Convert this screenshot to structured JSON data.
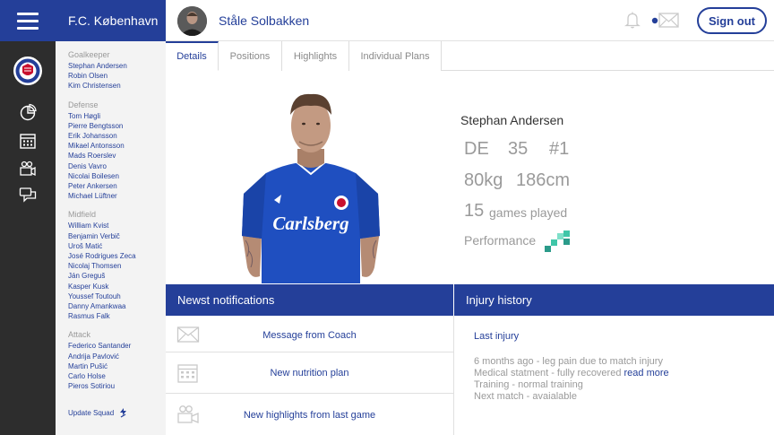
{
  "sidebar": {
    "team_name": "F.C. København",
    "groups": [
      {
        "title": "Goalkeeper",
        "players": [
          "Stephan Andersen",
          "Robin Olsen",
          "Kim Christensen"
        ]
      },
      {
        "title": "Defense",
        "players": [
          "Tom Høgli",
          "Pierre Bengtsson",
          "Erik Johansson",
          "Mikael Antonsson",
          "Mads Roerslev",
          "Denis Vavro",
          "Nicolai Boilesen",
          "Peter Ankersen",
          "Michael Lüftner"
        ]
      },
      {
        "title": "Midfield",
        "players": [
          "William Kvist",
          "Benjamin Verbič",
          "Uroš Matić",
          "José Rodrigues Zeca",
          "Nicolaj Thomsen",
          "Ján Greguš",
          "Kasper Kusk",
          "Youssef Toutouh",
          "Danny Amankwaa",
          "Rasmus Falk"
        ]
      },
      {
        "title": "Attack",
        "players": [
          "Federico Santander",
          "Andrija Pavlović",
          "Martin Pušić",
          "Carlo Holse",
          "Pieros Sotiriou"
        ]
      }
    ],
    "update_label": "Update Squad"
  },
  "header": {
    "coach_name": "Ståle Solbakken",
    "signout_label": "Sign out"
  },
  "tabs": [
    "Details",
    "Positions",
    "Highlights",
    "Individual Plans"
  ],
  "player": {
    "name": "Stephan Andersen",
    "position": "DE",
    "age": "35",
    "number": "#1",
    "weight": "80kg",
    "height": "186cm",
    "games_count": "15",
    "games_label": "games played",
    "performance_label": "Performance",
    "shirt_sponsor": "Carlsberg"
  },
  "notifications": {
    "title": "Newst notifications",
    "items": [
      {
        "icon": "envelope-icon",
        "text": "Message from Coach"
      },
      {
        "icon": "calendar-icon",
        "text": "New nutrition plan"
      },
      {
        "icon": "camera-icon",
        "text": "New highlights from last game"
      }
    ]
  },
  "injury": {
    "title": "Injury history",
    "subtitle": "Last injury",
    "line1": "6 months ago - leg pain due to match injury",
    "line2": "Medical statment - fully recovered",
    "read_more": "read more",
    "line3": "Training - normal training",
    "line4": "Next match - avaialable"
  },
  "colors": {
    "brand_blue": "#243f99",
    "rail_dark": "#2d2d2d",
    "sidebar_bg": "#f3f3f3",
    "muted_text": "#9a9a9a",
    "performance_teal": "#3fc6a8"
  }
}
